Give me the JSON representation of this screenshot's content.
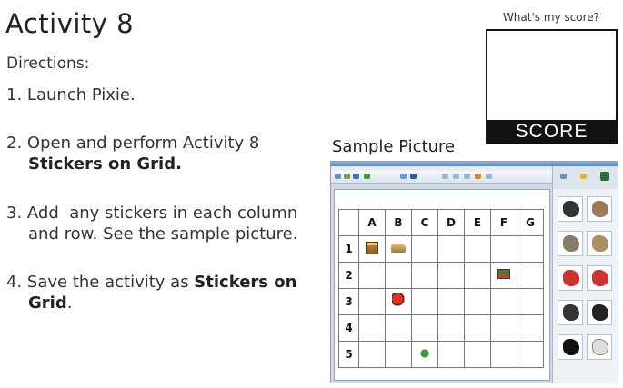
{
  "title": "Activity 8",
  "directions_label": "Directions:",
  "steps": [
    {
      "num": "1.",
      "text": "Launch Pixie."
    },
    {
      "num": "2.",
      "text": "Open and perform Activity 8",
      "bold": "Stickers on Grid."
    },
    {
      "num": "3.",
      "text1": "Add  any stickers in each column",
      "text2": "and row. See the sample picture."
    },
    {
      "num": "4.",
      "text1": "Save the activity as ",
      "bold1": "Stickers on",
      "bold2": "Grid",
      "tail": "."
    }
  ],
  "score": {
    "prompt": "What's my score?",
    "label": "SCORE"
  },
  "sample": {
    "title": "Sample Picture",
    "columns": [
      "A",
      "B",
      "C",
      "D",
      "E",
      "F",
      "G"
    ],
    "rows": [
      "1",
      "2",
      "3",
      "4",
      "5"
    ]
  },
  "colors": {
    "score_bar": "#111111",
    "grid_line": "#777777",
    "window_chrome": "#5b86c0"
  }
}
